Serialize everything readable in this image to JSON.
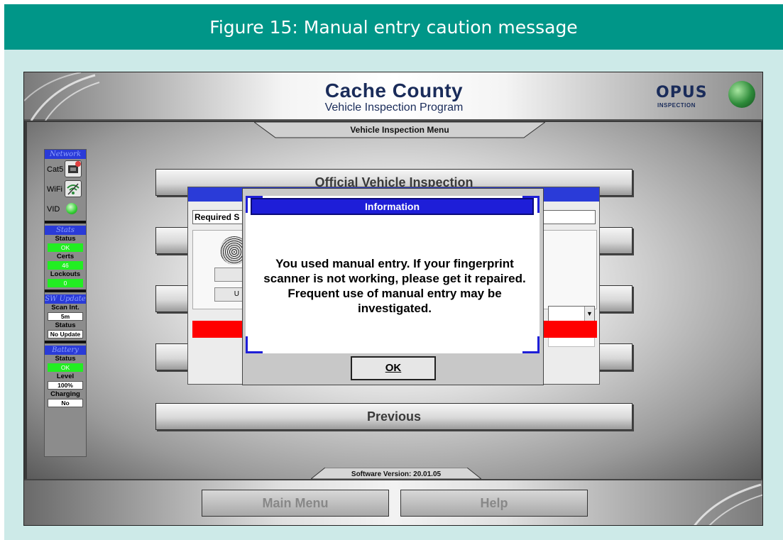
{
  "figure": {
    "caption": "Figure 15: Manual entry caution message"
  },
  "app": {
    "title": "Cache County",
    "subtitle": "Vehicle Inspection Program",
    "logo_text": "OPUS",
    "logo_subtext": "INSPECTION",
    "menu_title": "Vehicle Inspection Menu",
    "software_version": "Software Version: 20.01.05"
  },
  "sidebar": {
    "network_header": "Network",
    "cat5_label": "Cat5",
    "wifi_label": "WiFi",
    "vid_label": "VID",
    "stats_header": "Stats",
    "status_label": "Status",
    "status_value": "OK",
    "certs_label": "Certs",
    "certs_value": "46",
    "lockouts_label": "Lockouts",
    "lockouts_value": "0",
    "sw_update_header": "SW Update",
    "scan_int_label": "Scan Int.",
    "scan_int_value": "5m",
    "update_status_label": "Status",
    "update_status_value": "No Update",
    "battery_header": "Battery",
    "battery_status_label": "Status",
    "battery_status_value": "OK",
    "level_label": "Level",
    "level_value": "100%",
    "charging_label": "Charging",
    "charging_value": "No"
  },
  "menu": {
    "official_inspection": "Official Vehicle Inspection",
    "previous": "Previous"
  },
  "bottom": {
    "main_menu": "Main Menu",
    "help": "Help"
  },
  "back_dialog": {
    "required_label": "Required S"
  },
  "info_dialog": {
    "title": "Information",
    "message": "You used manual entry. If your fingerprint scanner is not working, please get it repaired. Frequent use of manual entry may be investigated.",
    "ok_label": "OK"
  },
  "colors": {
    "figure_header": "#009688",
    "figure_bg": "#cdeae8",
    "dialog_title": "#1e1ed8",
    "status_ok": "#22ee22",
    "alert_red": "#ff0000"
  }
}
